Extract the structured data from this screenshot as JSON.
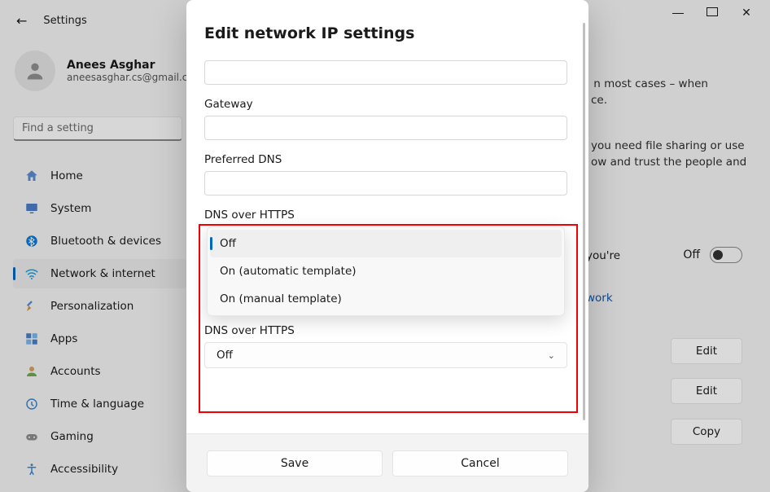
{
  "window": {
    "app_title": "Settings"
  },
  "user": {
    "name": "Anees Asghar",
    "email": "aneesasghar.cs@gmail.co"
  },
  "search": {
    "placeholder": "Find a setting"
  },
  "sidebar": {
    "items": [
      {
        "label": "Home",
        "icon": "home-icon"
      },
      {
        "label": "System",
        "icon": "system-icon"
      },
      {
        "label": "Bluetooth & devices",
        "icon": "bluetooth-icon"
      },
      {
        "label": "Network & internet",
        "icon": "wifi-icon",
        "active": true
      },
      {
        "label": "Personalization",
        "icon": "personalization-icon"
      },
      {
        "label": "Apps",
        "icon": "apps-icon"
      },
      {
        "label": "Accounts",
        "icon": "accounts-icon"
      },
      {
        "label": "Time & language",
        "icon": "time-icon"
      },
      {
        "label": "Gaming",
        "icon": "gaming-icon"
      },
      {
        "label": "Accessibility",
        "icon": "accessibility-icon"
      }
    ]
  },
  "background": {
    "line1": "n most cases – when",
    "line2": "ce.",
    "line3": "you need file sharing or use",
    "line4": "ow and trust the people and",
    "you_re": "you're",
    "toggle_label": "Off",
    "link_text": "work",
    "button_edit": "Edit",
    "button_copy": "Copy"
  },
  "dialog": {
    "title": "Edit network IP settings",
    "fields": {
      "gateway_label": "Gateway",
      "preferred_dns_label": "Preferred DNS",
      "dns_over_https_label": "DNS over HTTPS",
      "dns_over_https_label_2": "DNS over HTTPS"
    },
    "dropdown": {
      "options": [
        "Off",
        "On (automatic template)",
        "On (manual template)"
      ],
      "selected": "Off"
    },
    "second_select_value": "Off",
    "save": "Save",
    "cancel": "Cancel"
  }
}
